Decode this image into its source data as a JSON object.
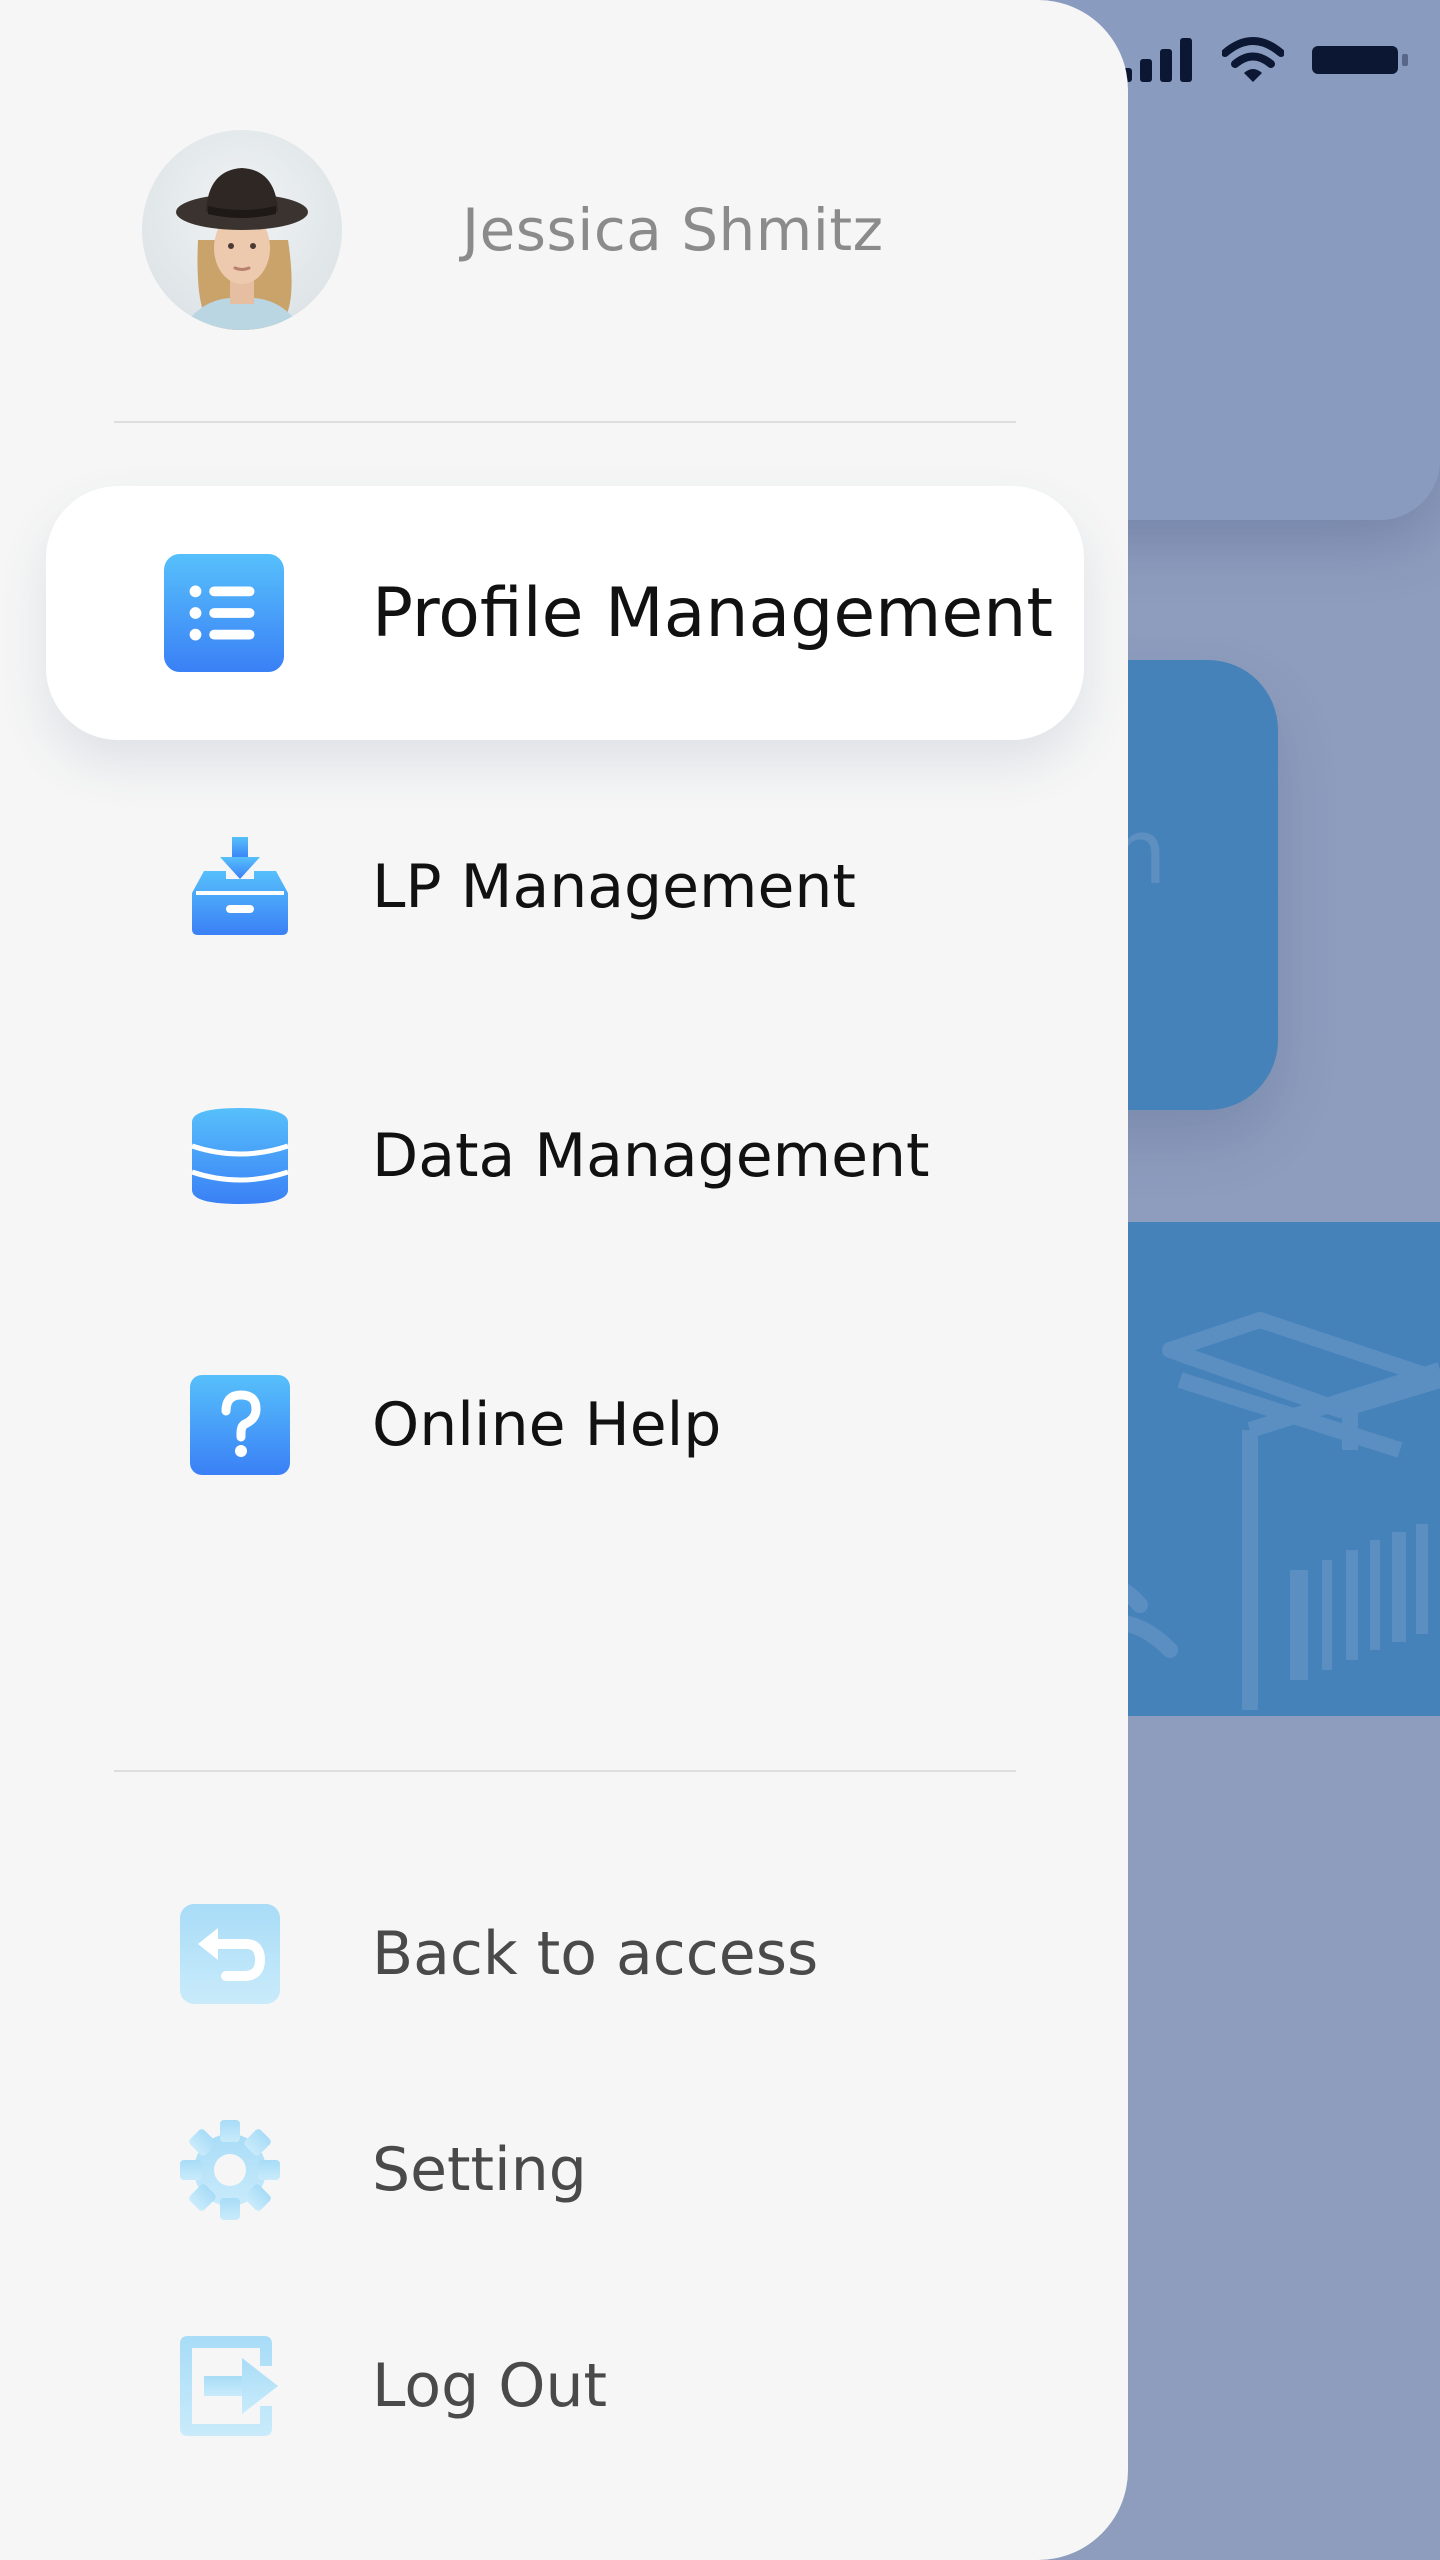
{
  "status_bar": {
    "signal_icon": "signal-bars-icon",
    "wifi_icon": "wifi-icon",
    "battery_icon": "battery-icon"
  },
  "drawer": {
    "profile": {
      "name": "Jessica Shmitz",
      "avatar_icon": "user-avatar"
    },
    "menu": [
      {
        "label": "Profile Management",
        "icon": "list-icon",
        "active": true
      },
      {
        "label": "LP Management",
        "icon": "inbox-download-icon",
        "active": false
      },
      {
        "label": "Data Management",
        "icon": "database-icon",
        "active": false
      },
      {
        "label": "Online Help",
        "icon": "question-icon",
        "active": false
      }
    ],
    "bottom": [
      {
        "label": "Back to access",
        "icon": "back-arrow-icon"
      },
      {
        "label": "Setting",
        "icon": "gear-icon"
      },
      {
        "label": "Log Out",
        "icon": "logout-icon"
      }
    ]
  },
  "colors": {
    "accent_blue": "#3a8ef6",
    "accent_light": "#a6dcf6",
    "overlay": "#8e9dbd",
    "drawer_bg": "#f6f6f6",
    "tile_blue": "#4682ba"
  }
}
